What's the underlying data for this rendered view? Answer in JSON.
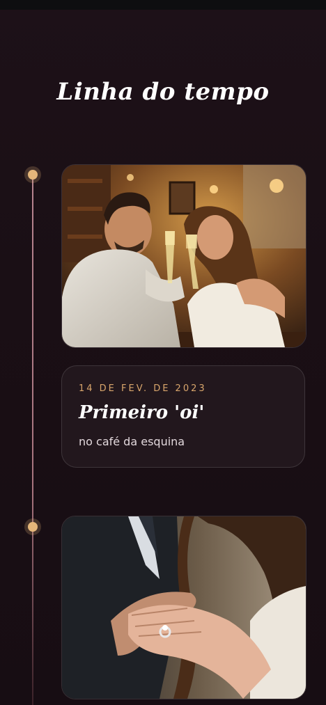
{
  "page": {
    "title": "Linha do tempo"
  },
  "timeline": {
    "events": [
      {
        "date": "14 DE FEV. DE 2023",
        "title": "Primeiro 'oi'",
        "subtitle": "no café da esquina",
        "photo": "couple-toasting-champagne-in-cafe"
      },
      {
        "photo": "hands-with-engagement-ring"
      }
    ]
  },
  "colors": {
    "accent": "#e4b67a",
    "date": "#d9a66c",
    "background": "#1a0f15",
    "line": "#b7848f"
  }
}
